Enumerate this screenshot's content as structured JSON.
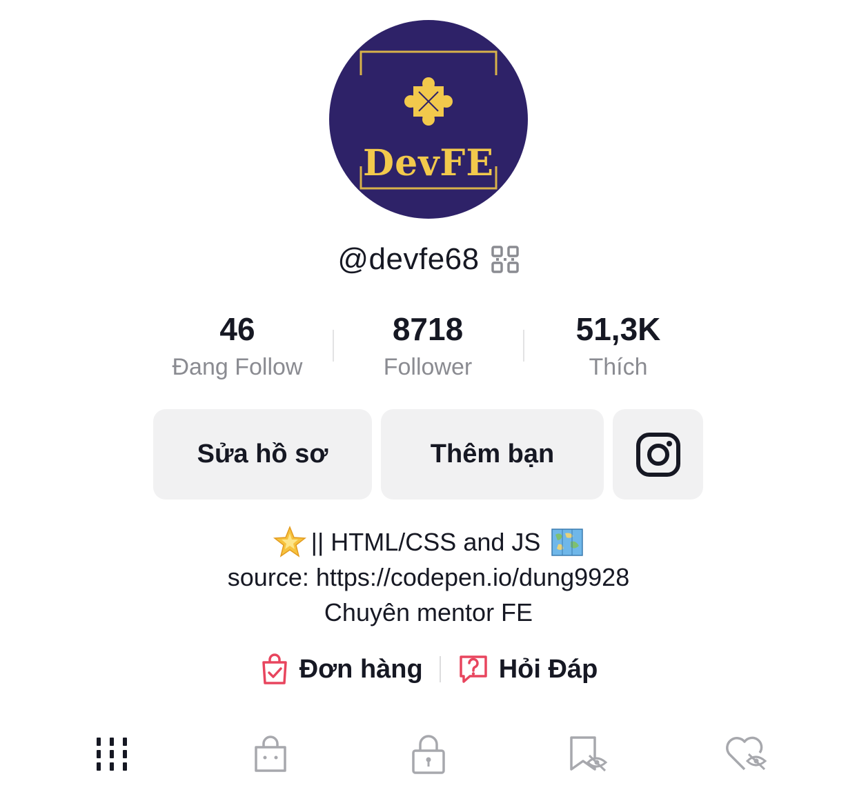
{
  "profile": {
    "avatar_text": "DevFE",
    "username": "@devfe68",
    "qr_icon": "qr-code-icon"
  },
  "stats": [
    {
      "value": "46",
      "label": "Đang Follow"
    },
    {
      "value": "8718",
      "label": "Follower"
    },
    {
      "value": "51,3K",
      "label": "Thích"
    }
  ],
  "buttons": {
    "edit_profile": "Sửa hồ sơ",
    "add_friends": "Thêm bạn",
    "instagram_icon": "instagram-icon"
  },
  "bio": {
    "line1": "|| HTML/CSS and JS",
    "line2": "source: https://codepen.io/dung9928",
    "line3": "Chuyên mentor FE",
    "emoji_start": "glowing-star-icon",
    "emoji_end": "world-map-icon"
  },
  "links": {
    "orders": "Đơn hàng",
    "qa": "Hỏi Đáp",
    "orders_icon": "shopping-bag-check-icon",
    "qa_icon": "question-bubble-icon"
  },
  "tabs": [
    {
      "icon": "grid-videos-icon"
    },
    {
      "icon": "shop-bag-icon"
    },
    {
      "icon": "lock-icon"
    },
    {
      "icon": "bookmark-hidden-icon"
    },
    {
      "icon": "heart-hidden-icon"
    }
  ],
  "colors": {
    "avatar_bg": "#2e2268",
    "avatar_accent": "#f2c94c",
    "link_icon_accent": "#e8455e",
    "button_bg": "#f1f1f2",
    "label_gray": "#8a8b91"
  }
}
